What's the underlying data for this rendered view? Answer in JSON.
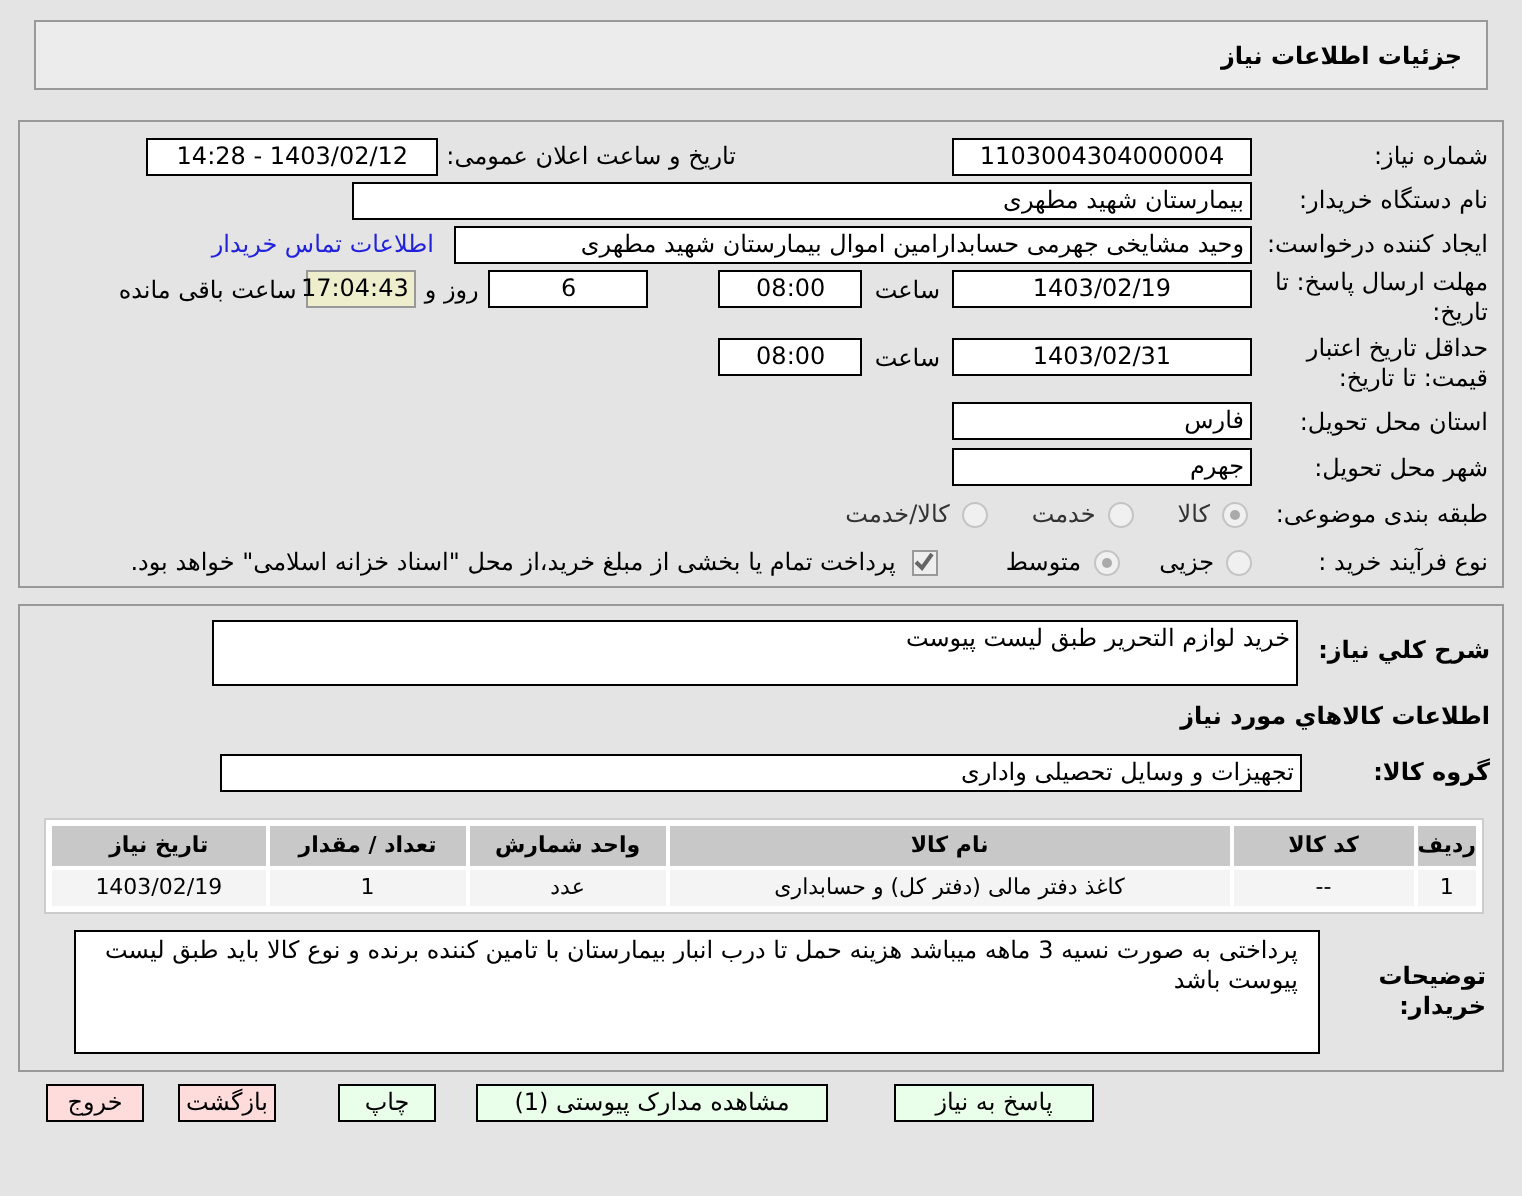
{
  "header": {
    "title": "جزئیات اطلاعات نیاز"
  },
  "need_number": {
    "label": "شماره نیاز:",
    "value": "1103004304000004"
  },
  "announce": {
    "label": "تاریخ و ساعت اعلان عمومی:",
    "value": "1403/02/12 - 14:28"
  },
  "buyer": {
    "label": "نام دستگاه خریدار:",
    "value": "بیمارستان شهید مطهری"
  },
  "creator": {
    "label": "ایجاد کننده درخواست:",
    "value": "وحید مشایخی جهرمی حسابدارامین اموال بیمارستان شهید مطهری",
    "link": "اطلاعات تماس خریدار"
  },
  "deadline": {
    "label": "مهلت ارسال پاسخ: تا تاریخ:",
    "date": "1403/02/19",
    "time_label": "ساعت",
    "time": "08:00",
    "days": "6",
    "days_label": "روز و",
    "remaining": "17:04:43",
    "remaining_label": "ساعت باقی مانده"
  },
  "validity": {
    "label": "حداقل تاریخ اعتبار قیمت: تا تاریخ:",
    "date": "1403/02/31",
    "time_label": "ساعت",
    "time": "08:00"
  },
  "province": {
    "label": "استان محل تحویل:",
    "value": "فارس"
  },
  "city": {
    "label": "شهر محل تحویل:",
    "value": "جهرم"
  },
  "category": {
    "label": "طبقه بندی موضوعی:",
    "options": [
      {
        "label": "کالا",
        "selected": true,
        "disabled": true
      },
      {
        "label": "خدمت",
        "selected": false,
        "disabled": true
      },
      {
        "label": "کالا/خدمت",
        "selected": false,
        "disabled": true
      }
    ]
  },
  "process": {
    "label": "نوع فرآیند خرید :",
    "options": [
      {
        "label": "جزیی",
        "selected": false,
        "disabled": true
      },
      {
        "label": "متوسط",
        "selected": true,
        "disabled": true
      }
    ],
    "payment": {
      "label": "پرداخت تمام یا بخشی از مبلغ خرید،از محل \"اسناد خزانه اسلامی\" خواهد بود.",
      "checked": true,
      "disabled": true
    }
  },
  "description": {
    "label": "شرح کلي نياز:",
    "value": "خرید لوازم التحریر طبق لیست پیوست"
  },
  "goods_title": "اطلاعات کالاهاي مورد نياز",
  "goods_group": {
    "label": "گروه کالا:",
    "value": "تجهیزات و وسایل تحصیلی واداری"
  },
  "table": {
    "columns": [
      "ردیف",
      "کد کالا",
      "نام کالا",
      "واحد شمارش",
      "تعداد / مقدار",
      "تاریخ نیاز"
    ],
    "rows": [
      [
        "1",
        "--",
        "کاغذ دفتر مالی (دفتر کل) و حسابداری",
        "عدد",
        "1",
        "1403/02/19"
      ]
    ]
  },
  "notes": {
    "label": "توضیحات خریدار:",
    "value": "پرداختی به صورت نسیه 3 ماهه میباشد هزینه حمل تا درب انبار بیمارستان با تامین کننده برنده و نوع کالا باید طبق لیست پیوست باشد"
  },
  "buttons": [
    {
      "label": "پاسخ به نیاز",
      "kind": "green"
    },
    {
      "label": "مشاهده مدارک پیوستی (1)",
      "kind": "green"
    },
    {
      "label": "چاپ",
      "kind": "green"
    },
    {
      "label": "بازگشت",
      "kind": "red"
    },
    {
      "label": "خروج",
      "kind": "red"
    }
  ]
}
